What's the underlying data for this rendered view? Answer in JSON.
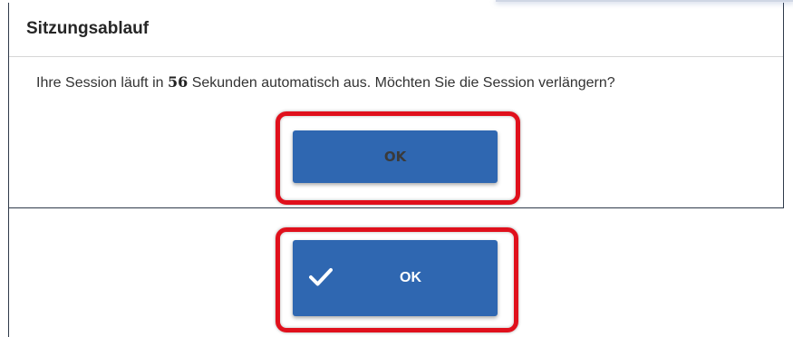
{
  "dialog": {
    "title": "Sitzungsablauf",
    "message_prefix": "Ihre Session läuft in",
    "seconds": "56",
    "message_suffix": "Sekunden automatisch aus. Möchten Sie die Session verlängern?",
    "ok_label": "OK"
  },
  "new_button": {
    "icon": "checkmark-icon",
    "label": "OK"
  },
  "colors": {
    "button_blue": "#2f67b1",
    "highlight_red": "#e0101c",
    "title_text": "#262626"
  }
}
